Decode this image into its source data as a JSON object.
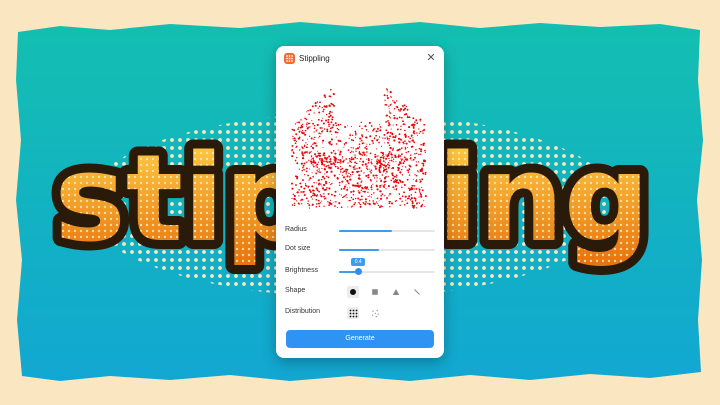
{
  "background": {
    "banner_text": "stippling",
    "colors": {
      "frame": "#fbe6c2",
      "teal_top": "#13bfb0",
      "teal_bottom": "#12a7d2",
      "text_orange": "#f09a12",
      "text_outline": "#2a1a0a"
    }
  },
  "panel": {
    "title": "Stippling",
    "icon": "grid-app-icon",
    "close_icon": "close-icon",
    "preview": {
      "subject": "cat-stipple-image",
      "dot_color": "#e8060a"
    },
    "controls": {
      "radius": {
        "label": "Radius",
        "value": 0.55
      },
      "dot_size": {
        "label": "Dot size",
        "value": 0.42
      },
      "brightness": {
        "label": "Brightness",
        "value": 0.2,
        "display": "0.4"
      },
      "shape": {
        "label": "Shape",
        "options": [
          "circle-shape-icon",
          "square-shape-icon",
          "triangle-shape-icon",
          "line-shape-icon"
        ],
        "selected": 0
      },
      "distribution": {
        "label": "Distribution",
        "options": [
          "grid-distribution-icon",
          "random-distribution-icon"
        ],
        "selected": 0
      }
    },
    "generate_label": "Generate",
    "accent": "#2e93f2"
  }
}
